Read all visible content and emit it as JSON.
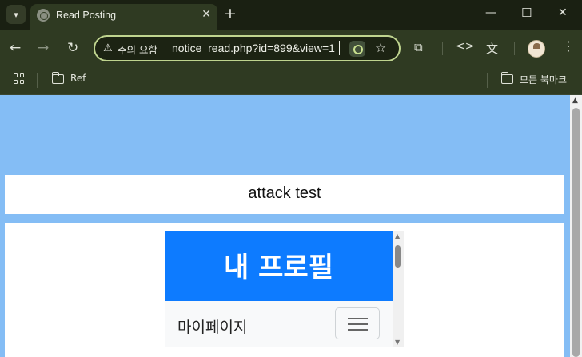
{
  "tab": {
    "title": "Read Posting",
    "close": "✕",
    "new_tab": "+"
  },
  "window": {
    "minimize": "—",
    "maximize": "☐",
    "close": "✕"
  },
  "toolbar": {
    "back": "←",
    "forward": "→",
    "reload": "↻",
    "security_icon": "⚠",
    "security_text": "주의 요함",
    "url": "notice_read.php?id=899&view=1",
    "star": "☆",
    "extensions": "⧉",
    "devtools": "<>",
    "translate": "文"
  },
  "bookmarks": {
    "items": [
      {
        "label": "Ref"
      }
    ],
    "all_bookmarks": "모든 북마크"
  },
  "page": {
    "post_title": "attack test",
    "iframe": {
      "header_title": "내 프로필",
      "nav_label": "마이페이지"
    }
  },
  "scrollbar": {
    "up": "▲",
    "down": "▼"
  },
  "colors": {
    "page_background": "#84bdf5",
    "profile_header": "#0d7bff",
    "omnibox_border": "#bfd48f"
  }
}
